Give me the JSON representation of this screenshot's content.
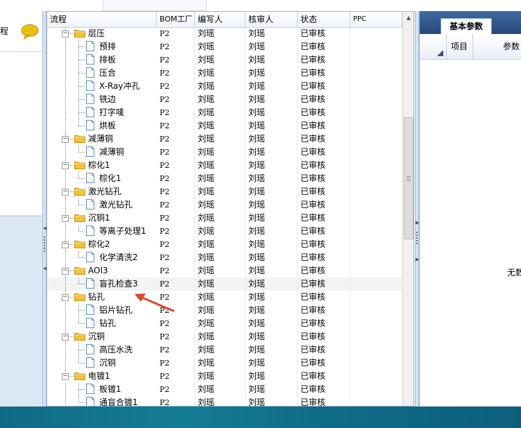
{
  "left_panel": {
    "title": "程"
  },
  "grid": {
    "columns": [
      "流程",
      "BOM工厂",
      "编写人",
      "核审人",
      "状态",
      "PPC"
    ],
    "rows": [
      {
        "name": "层压",
        "level": 0,
        "type": "folder",
        "factory": "P2",
        "writer": "刘瑶",
        "reviewer": "刘瑶",
        "status": "已审核"
      },
      {
        "name": "预排",
        "level": 1,
        "type": "doc",
        "factory": "P2",
        "writer": "刘瑶",
        "reviewer": "刘瑶",
        "status": "已审核"
      },
      {
        "name": "排板",
        "level": 1,
        "type": "doc",
        "factory": "P2",
        "writer": "刘瑶",
        "reviewer": "刘瑶",
        "status": "已审核"
      },
      {
        "name": "压合",
        "level": 1,
        "type": "doc",
        "factory": "P2",
        "writer": "刘瑶",
        "reviewer": "刘瑶",
        "status": "已审核"
      },
      {
        "name": "X-Ray冲孔",
        "level": 1,
        "type": "doc",
        "factory": "P2",
        "writer": "刘瑶",
        "reviewer": "刘瑶",
        "status": "已审核"
      },
      {
        "name": "铣边",
        "level": 1,
        "type": "doc",
        "factory": "P2",
        "writer": "刘瑶",
        "reviewer": "刘瑶",
        "status": "已审核"
      },
      {
        "name": "打字唛",
        "level": 1,
        "type": "doc",
        "factory": "P2",
        "writer": "刘瑶",
        "reviewer": "刘瑶",
        "status": "已审核"
      },
      {
        "name": "烘板",
        "level": 1,
        "type": "doc",
        "factory": "P2",
        "writer": "刘瑶",
        "reviewer": "刘瑶",
        "status": "已审核"
      },
      {
        "name": "减薄铜",
        "level": 0,
        "type": "folder",
        "factory": "P2",
        "writer": "刘瑶",
        "reviewer": "刘瑶",
        "status": "已审核"
      },
      {
        "name": "减薄铜",
        "level": 1,
        "type": "doc",
        "factory": "P2",
        "writer": "刘瑶",
        "reviewer": "刘瑶",
        "status": "已审核"
      },
      {
        "name": "棕化1",
        "level": 0,
        "type": "folder",
        "factory": "P2",
        "writer": "刘瑶",
        "reviewer": "刘瑶",
        "status": "已审核"
      },
      {
        "name": "棕化1",
        "level": 1,
        "type": "doc",
        "factory": "P2",
        "writer": "刘瑶",
        "reviewer": "刘瑶",
        "status": "已审核"
      },
      {
        "name": "激光钻孔",
        "level": 0,
        "type": "folder",
        "factory": "P2",
        "writer": "刘瑶",
        "reviewer": "刘瑶",
        "status": "已审核"
      },
      {
        "name": "激光钻孔",
        "level": 1,
        "type": "doc",
        "factory": "P2",
        "writer": "刘瑶",
        "reviewer": "刘瑶",
        "status": "已审核"
      },
      {
        "name": "沉铜1",
        "level": 0,
        "type": "folder",
        "factory": "P2",
        "writer": "刘瑶",
        "reviewer": "刘瑶",
        "status": "已审核"
      },
      {
        "name": "等离子处理1",
        "level": 1,
        "type": "doc",
        "factory": "P2",
        "writer": "刘瑶",
        "reviewer": "刘瑶",
        "status": "已审核"
      },
      {
        "name": "棕化2",
        "level": 0,
        "type": "folder",
        "factory": "P2",
        "writer": "刘瑶",
        "reviewer": "刘瑶",
        "status": "已审核"
      },
      {
        "name": "化学清洗2",
        "level": 1,
        "type": "doc",
        "factory": "P2",
        "writer": "刘瑶",
        "reviewer": "刘瑶",
        "status": "已审核"
      },
      {
        "name": "AOI3",
        "level": 0,
        "type": "folder",
        "factory": "P2",
        "writer": "刘瑶",
        "reviewer": "刘瑶",
        "status": "已审核"
      },
      {
        "name": "盲孔检查3",
        "level": 1,
        "type": "doc",
        "factory": "P2",
        "writer": "刘瑶",
        "reviewer": "刘瑶",
        "status": "已审核",
        "selected": true
      },
      {
        "name": "钻孔",
        "level": 0,
        "type": "folder",
        "factory": "P2",
        "writer": "刘瑶",
        "reviewer": "刘瑶",
        "status": "已审核"
      },
      {
        "name": "铝片钻孔",
        "level": 1,
        "type": "doc",
        "factory": "P2",
        "writer": "刘瑶",
        "reviewer": "刘瑶",
        "status": "已审核"
      },
      {
        "name": "钻孔",
        "level": 1,
        "type": "doc",
        "factory": "P2",
        "writer": "刘瑶",
        "reviewer": "刘瑶",
        "status": "已审核"
      },
      {
        "name": "沉铜",
        "level": 0,
        "type": "folder",
        "factory": "P2",
        "writer": "刘瑶",
        "reviewer": "刘瑶",
        "status": "已审核"
      },
      {
        "name": "高压水洗",
        "level": 1,
        "type": "doc",
        "factory": "P2",
        "writer": "刘瑶",
        "reviewer": "刘瑶",
        "status": "已审核"
      },
      {
        "name": "沉铜",
        "level": 1,
        "type": "doc",
        "factory": "P2",
        "writer": "刘瑶",
        "reviewer": "刘瑶",
        "status": "已审核"
      },
      {
        "name": "电镀1",
        "level": 0,
        "type": "folder",
        "factory": "P2",
        "writer": "刘瑶",
        "reviewer": "刘瑶",
        "status": "已审核"
      },
      {
        "name": "板镀1",
        "level": 1,
        "type": "doc",
        "factory": "P2",
        "writer": "刘瑶",
        "reviewer": "刘瑶",
        "status": "已审核"
      },
      {
        "name": "通盲合镀1",
        "level": 1,
        "type": "doc",
        "factory": "P2",
        "writer": "刘瑶",
        "reviewer": "刘瑶",
        "status": "已审核"
      }
    ]
  },
  "right_panel": {
    "tab": "基本参数",
    "columns": [
      "项目",
      "参数"
    ],
    "empty_text": "无数"
  },
  "colors": {
    "selected_row": "#f3f3f3",
    "annotation_arrow": "#e0452b",
    "folder": "#f2c23c",
    "tab_bar": "#2f5a8e"
  }
}
